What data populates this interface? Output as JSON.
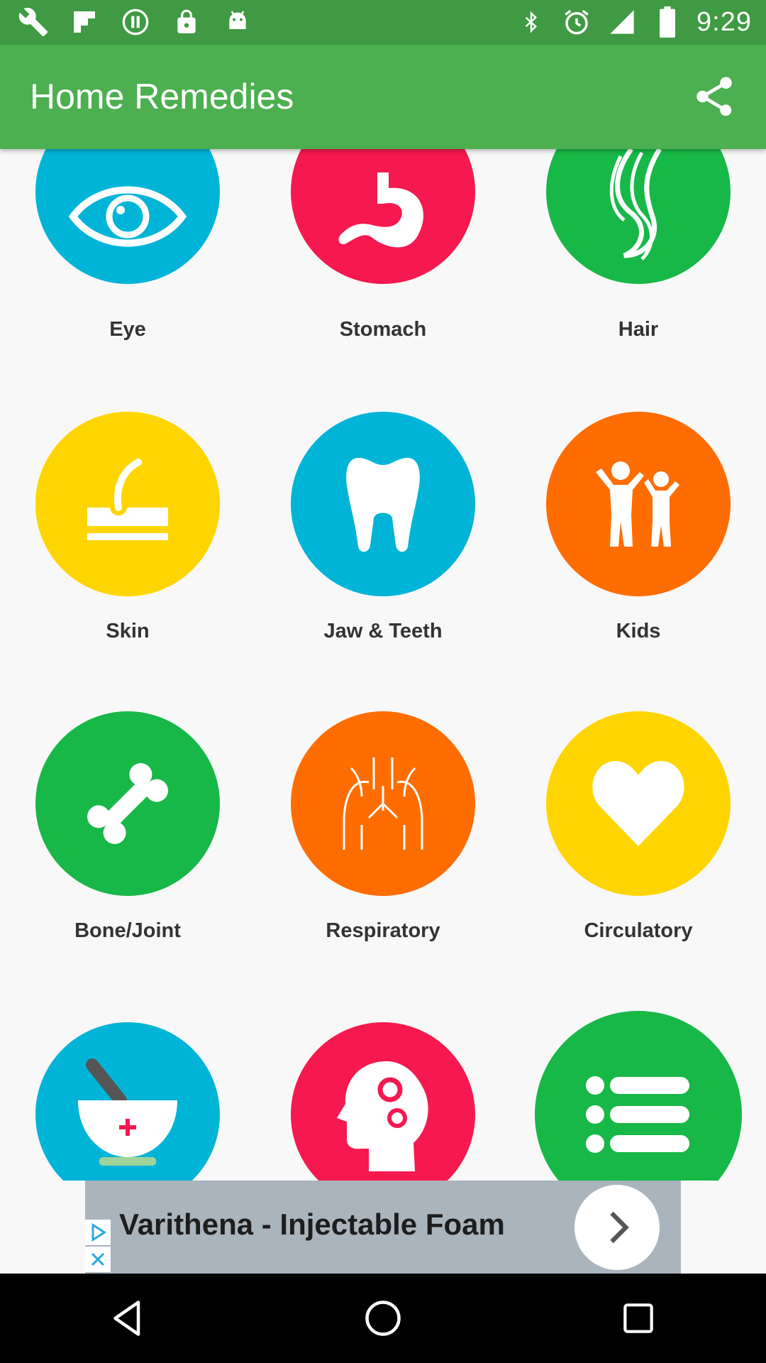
{
  "status_bar": {
    "time": "9:29",
    "left_icons": [
      "wrench-icon",
      "flipboard-icon",
      "circle-pause-icon",
      "lock-icon",
      "android-icon"
    ],
    "right_icons": [
      "bluetooth-icon",
      "alarm-icon",
      "signal-icon",
      "battery-icon"
    ]
  },
  "app_bar": {
    "title": "Home Remedies",
    "share_icon": "share-icon"
  },
  "categories": [
    {
      "label": "Eye",
      "icon": "eye-icon",
      "color": "#00b4d8"
    },
    {
      "label": "Stomach",
      "icon": "stomach-icon",
      "color": "#f5194f"
    },
    {
      "label": "Hair",
      "icon": "hair-icon",
      "color": "#17b847"
    },
    {
      "label": "Skin",
      "icon": "skin-icon",
      "color": "#ffd500"
    },
    {
      "label": "Jaw & Teeth",
      "icon": "tooth-icon",
      "color": "#00b4d8"
    },
    {
      "label": "Kids",
      "icon": "kids-icon",
      "color": "#ff6d00"
    },
    {
      "label": "Bone/Joint",
      "icon": "bone-icon",
      "color": "#17b847"
    },
    {
      "label": "Respiratory",
      "icon": "lungs-icon",
      "color": "#ff6d00"
    },
    {
      "label": "Circulatory",
      "icon": "heart-icon",
      "color": "#ffd500"
    },
    {
      "label": "",
      "icon": "mortar-pestle-icon",
      "color": "#00b4d8"
    },
    {
      "label": "",
      "icon": "head-gears-icon",
      "color": "#f5194f"
    },
    {
      "label": "",
      "icon": "list-icon",
      "color": "#17b847"
    }
  ],
  "ad_banner": {
    "text": "Varithena - Injectable Foam"
  },
  "nav_bar": {
    "buttons": [
      "back-icon",
      "home-icon",
      "recents-icon"
    ]
  }
}
